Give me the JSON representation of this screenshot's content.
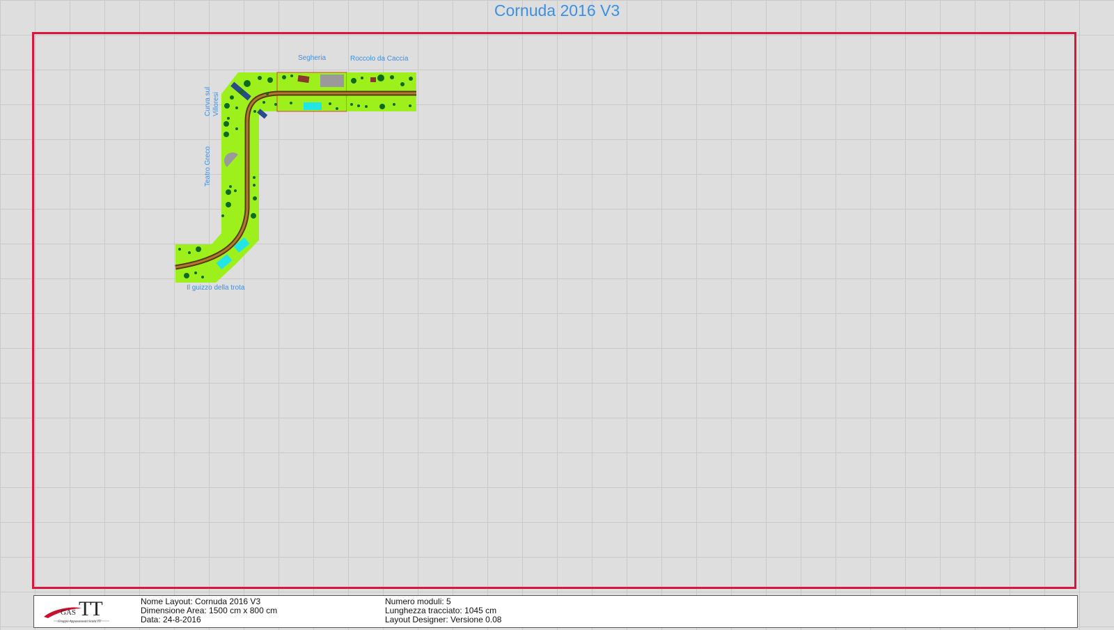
{
  "title": "Cornuda 2016 V3",
  "colors": {
    "frame": "#dc143c",
    "title": "#3d8fe6",
    "grass": "#9df01c",
    "tree": "#0f6a1f",
    "track": "#8a5a18",
    "water": "#22e6e6"
  },
  "modules": {
    "segheria": "Segheria",
    "roccolo": "Roccolo da Caccia",
    "curva_line1": "Curva sul",
    "curva_line2": "Villoresi",
    "teatro": "Teatro Greco",
    "guizzo": "Il guizzo della trota"
  },
  "info": {
    "nome_layout": "Nome Layout: Cornuda 2016 V3",
    "dimensione": "Dimensione Area: 1500 cm x 800 cm",
    "data": "Data: 24-8-2016",
    "numero_moduli": "Numero moduli: 5",
    "lunghezza": "Lunghezza tracciato: 1045 cm",
    "designer": "Layout Designer: Versione 0.08"
  },
  "logo": {
    "gas": "GAS",
    "tt": "TT",
    "subtitle": "Gruppo Appassionati Scala TT"
  }
}
